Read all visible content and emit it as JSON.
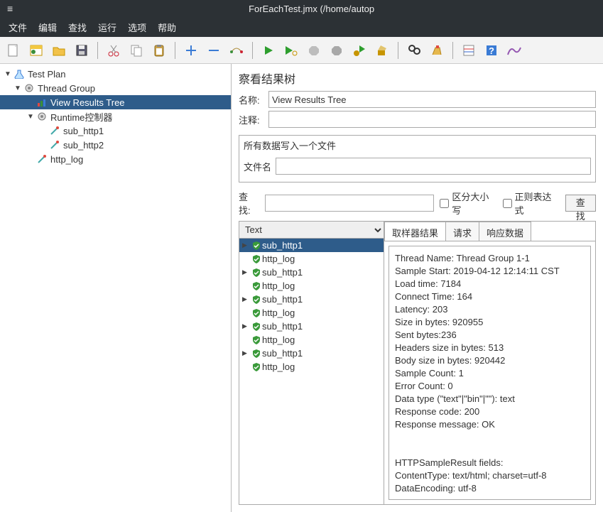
{
  "window": {
    "title": "ForEachTest.jmx (/home/autop"
  },
  "menu": [
    "文件",
    "编辑",
    "查找",
    "运行",
    "选项",
    "帮助"
  ],
  "tree": {
    "root": "Test Plan",
    "group": "Thread Group",
    "view": "View Results Tree",
    "runtime": "Runtime控制器",
    "sub1": "sub_http1",
    "sub2": "sub_http2",
    "log": "http_log"
  },
  "panel": {
    "title": "察看结果树",
    "name_lbl": "名称:",
    "name_val": "View Results Tree",
    "note_lbl": "注释:",
    "note_val": "",
    "file_section": "所有数据写入一个文件",
    "file_lbl": "文件名",
    "file_val": "",
    "search_lbl": "查找:",
    "search_val": "",
    "case_chk": "区分大小写",
    "regex_chk": "正则表达式",
    "search_btn": "查找"
  },
  "res": {
    "mode": "Text",
    "items": [
      {
        "name": "sub_http1",
        "child": true
      },
      {
        "name": "http_log",
        "child": false
      },
      {
        "name": "sub_http1",
        "child": true
      },
      {
        "name": "http_log",
        "child": false
      },
      {
        "name": "sub_http1",
        "child": true
      },
      {
        "name": "http_log",
        "child": false
      },
      {
        "name": "sub_http1",
        "child": true
      },
      {
        "name": "http_log",
        "child": false
      },
      {
        "name": "sub_http1",
        "child": true
      },
      {
        "name": "http_log",
        "child": false
      }
    ]
  },
  "tabs": {
    "sampler": "取样器结果",
    "request": "请求",
    "response": "响应数据"
  },
  "detail_lines": [
    "Thread Name: Thread Group 1-1",
    "Sample Start: 2019-04-12 12:14:11 CST",
    "Load time: 7184",
    "Connect Time: 164",
    "Latency: 203",
    "Size in bytes: 920955",
    "Sent bytes:236",
    "Headers size in bytes: 513",
    "Body size in bytes: 920442",
    "Sample Count: 1",
    "Error Count: 0",
    "Data type (\"text\"|\"bin\"|\"\"): text",
    "Response code: 200",
    "Response message: OK",
    "",
    "",
    "HTTPSampleResult fields:",
    "ContentType: text/html; charset=utf-8",
    "DataEncoding: utf-8"
  ]
}
